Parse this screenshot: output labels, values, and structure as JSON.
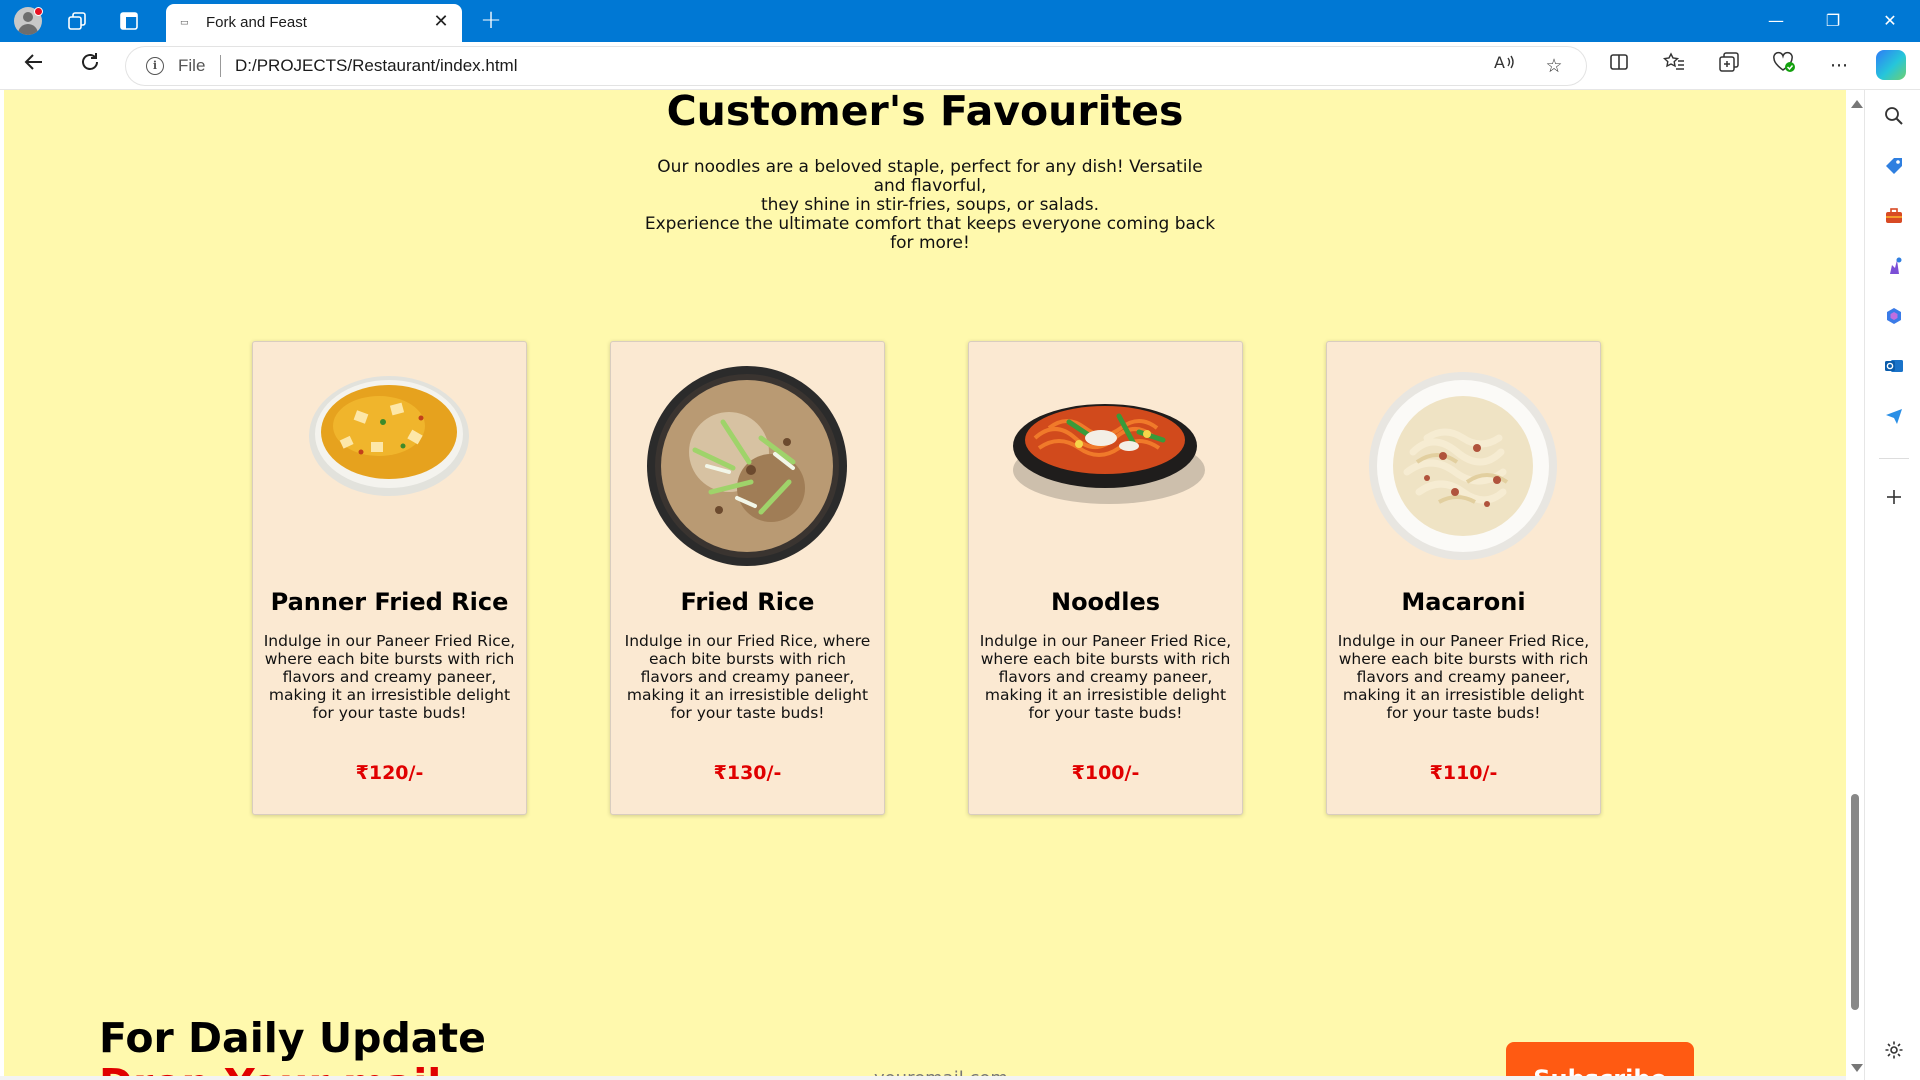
{
  "browser": {
    "tab_title": "Fork and Feast",
    "tab_close": "✕",
    "new_tab": "+",
    "url_scheme_label": "File",
    "url_path": "D:/PROJECTS/Restaurant/index.html",
    "window_controls": {
      "minimize": "—",
      "restore": "❐",
      "close": "✕"
    }
  },
  "page": {
    "section_title": "Customer's Favourites",
    "section_description": "Our noodles are a beloved staple, perfect for any dish! Versatile and flavorful,\nthey shine in stir-fries, soups, or salads.\nExperience the ultimate comfort that keeps everyone coming back for more!",
    "cards": [
      {
        "title": "Panner Fried Rice",
        "description": "Indulge in our Paneer Fried Rice, where each bite bursts with rich flavors and creamy paneer,\nmaking it an irresistible delight for your taste buds!",
        "price": "₹120/-"
      },
      {
        "title": "Fried Rice",
        "description": "Indulge in our Fried Rice, where each bite bursts with rich flavors and creamy paneer,\nmaking it an irresistible delight for your taste buds!",
        "price": "₹130/-"
      },
      {
        "title": "Noodles",
        "description": "Indulge in our Paneer Fried Rice, where each bite bursts with rich flavors and creamy paneer,\nmaking it an irresistible delight for your taste buds!",
        "price": "₹100/-"
      },
      {
        "title": "Macaroni",
        "description": "Indulge in our Paneer Fried Rice, where each bite bursts with rich flavors and creamy paneer,\nmaking it an irresistible delight for your taste buds!",
        "price": "₹110/-"
      }
    ],
    "newsletter": {
      "title": "For Daily Update",
      "subtitle": "Drop Your mail",
      "email_placeholder": "youremail.com",
      "subscribe_label": "Subscribe"
    }
  },
  "colors": {
    "page_background": "#fff9ad",
    "card_background": "#fbe9d2",
    "price": "#e00000",
    "subscribe_button": "#ff5a12",
    "titlebar": "#0078d4"
  }
}
